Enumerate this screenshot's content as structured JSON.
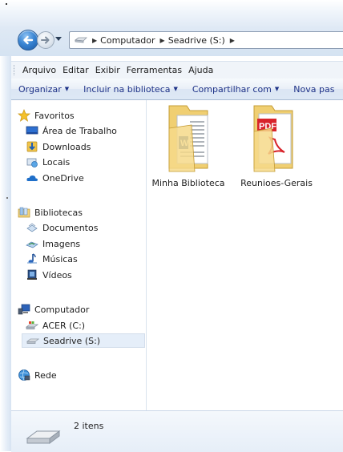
{
  "nav": {
    "back_icon": "back-arrow",
    "forward_icon": "forward-arrow"
  },
  "address": {
    "crumbs": [
      "Computador",
      "Seadrive (S:)"
    ]
  },
  "menu": {
    "items": [
      "Arquivo",
      "Editar",
      "Exibir",
      "Ferramentas",
      "Ajuda"
    ]
  },
  "commands": {
    "items": [
      "Organizar",
      "Incluir na biblioteca",
      "Compartilhar com",
      "Nova pas"
    ]
  },
  "sidebar": {
    "favorites": {
      "label": "Favoritos",
      "items": [
        "Área de Trabalho",
        "Downloads",
        "Locais",
        "OneDrive"
      ]
    },
    "libraries": {
      "label": "Bibliotecas",
      "items": [
        "Documentos",
        "Imagens",
        "Músicas",
        "Vídeos"
      ]
    },
    "computer": {
      "label": "Computador",
      "items": [
        "ACER (C:)",
        "Seadrive (S:)"
      ]
    },
    "network": {
      "label": "Rede"
    }
  },
  "files": [
    {
      "name": "Minha Biblioteca",
      "icon": "folder-word-icon"
    },
    {
      "name": "Reunioes-Gerais",
      "icon": "folder-pdf-icon",
      "badge": "PDF"
    }
  ],
  "status": {
    "count": "2 itens"
  },
  "colors": {
    "accent": "#1e3287",
    "selection": "#e5eef9",
    "pdf_red": "#d8242b",
    "folder": "#f2d27a"
  }
}
